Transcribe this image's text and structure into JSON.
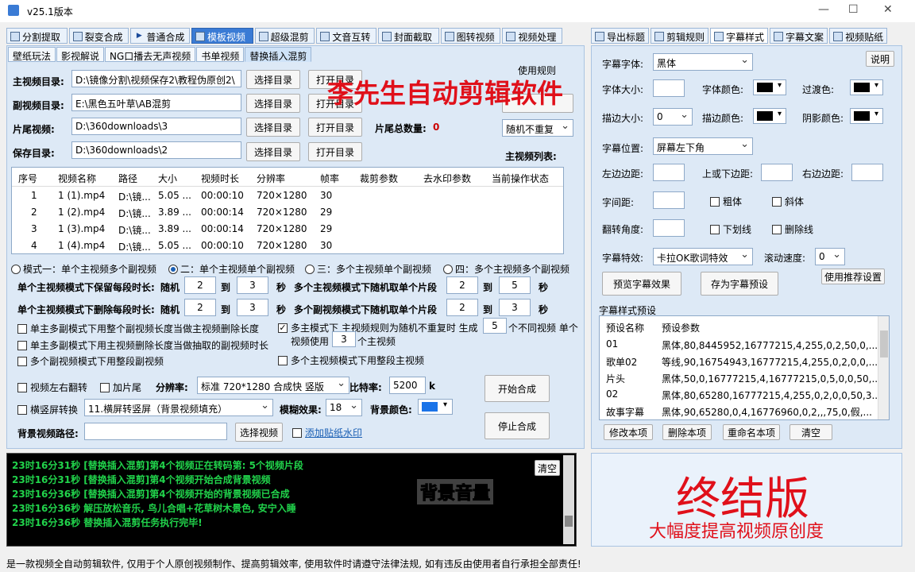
{
  "window": {
    "title": "v25.1版本",
    "min": "—",
    "max": "☐",
    "close": "✕"
  },
  "main_tabs": [
    {
      "label": "分割提取",
      "icon": "film-icon"
    },
    {
      "label": "裂变合成",
      "icon": "layers-icon"
    },
    {
      "label": "普通合成",
      "icon": "play-icon"
    },
    {
      "label": "模板视频",
      "icon": "template-icon",
      "active": true
    },
    {
      "label": "超级混剪",
      "icon": "waveform-icon"
    },
    {
      "label": "文音互转",
      "icon": "microphone-icon"
    },
    {
      "label": "封面截取",
      "icon": "image-icon"
    },
    {
      "label": "图转视频",
      "icon": "picture-video-icon"
    },
    {
      "label": "视频处理",
      "icon": "video-process-icon"
    }
  ],
  "sub_tabs": [
    "壁纸玩法",
    "影视解说",
    "NG口播去无声视频",
    "书单视频",
    "替换插入混剪"
  ],
  "overlay": {
    "title": "李先生自动剪辑软件",
    "big": "终结版",
    "sub": "大幅度提高视频原创度",
    "caption": "背景音量"
  },
  "form": {
    "main_dir_label": "主视频目录:",
    "main_dir_value": "D:\\镜像分割\\视频保存2\\教程伪原创2\\",
    "sub_dir_label": "副视频目录:",
    "sub_dir_value": "E:\\黑色五叶草\\AB混剪",
    "tail_label": "片尾视频:",
    "tail_value": "D:\\360downloads\\3",
    "save_label": "保存目录:",
    "save_value": "D:\\360downloads\\2",
    "select_dir": "选择目录",
    "open_dir": "打开目录",
    "tail_count_label": "片尾总数量:",
    "tail_count": "0",
    "rules_label": "使用规则",
    "rule_select": "随机不重复",
    "main_list_label": "主视频列表:"
  },
  "table": {
    "headers": [
      "序号",
      "视频名称",
      "路径",
      "大小",
      "视频时长",
      "分辨率",
      "帧率",
      "裁剪参数",
      "去水印参数",
      "当前操作状态"
    ],
    "rows": [
      [
        "1",
        "1 (1).mp4",
        "D:\\镜...",
        "5.05 ...",
        "00:00:10",
        "720×1280",
        "30"
      ],
      [
        "2",
        "1 (2).mp4",
        "D:\\镜...",
        "3.89 ...",
        "00:00:14",
        "720×1280",
        "29"
      ],
      [
        "3",
        "1 (3).mp4",
        "D:\\镜...",
        "3.89 ...",
        "00:00:14",
        "720×1280",
        "29"
      ],
      [
        "4",
        "1 (4).mp4",
        "D:\\镜...",
        "5.05 ...",
        "00:00:10",
        "720×1280",
        "30"
      ]
    ]
  },
  "modes": [
    {
      "label": "模式一：单个主视频多个副视频",
      "checked": false
    },
    {
      "label": "二：单个主视频单个副视频",
      "checked": true
    },
    {
      "label": "三：多个主视频单个副视频",
      "checked": false
    },
    {
      "label": "四：多个主视频多个副视频",
      "checked": false
    }
  ],
  "params": {
    "keep_label": "单个主视频模式下保留每段时长:",
    "random": "随机",
    "to": "到",
    "sec": "秒",
    "keep_min": "2",
    "keep_max": "3",
    "del_label": "单个主视频模式下删除每段时长:",
    "del_min": "2",
    "del_max": "3",
    "multi_main_label": "多个主视频模式下随机取单个片段",
    "mm_min": "2",
    "mm_max": "5",
    "multi_sub_label": "多个副视频模式下随机取单个片段",
    "ms_min": "2",
    "ms_max": "3"
  },
  "checks": {
    "c1": "单主多副模式下用整个副视频长度当做主视频删除长度",
    "c2": "单主多副模式下用主视频删除长度当做抽取的副视频时长",
    "c3": "多个副视频模式下用整段副视频",
    "c4a": "多主模式下 主视频规则为随机不重复时 生成",
    "c4_count": "5",
    "c4b": "个不同视频 单个",
    "c4c": "视频使用",
    "c4_use": "3",
    "c4d": "个主视频",
    "c5": "多个主视频模式下用整段主视频"
  },
  "bottom": {
    "flip": "视频左右翻转",
    "tail": "加片尾",
    "res_label": "分辨率:",
    "res_value": "标准 720*1280 合成快 竖版",
    "bitrate_label": "比特率:",
    "bitrate": "5200",
    "k": "k",
    "landscape": "横竖屏转换",
    "landscape_value": "11.横屏转竖屏（背景视频填充）",
    "blur_label": "模糊效果:",
    "blur_value": "18",
    "bg_color_label": "背景颜色:",
    "bg_color": "#1a73e8",
    "bg_path_label": "背景视频路径:",
    "select_video": "选择视频",
    "watermark": "添加贴纸水印",
    "start": "开始合成",
    "stop": "停止合成"
  },
  "right_tabs": [
    {
      "label": "导出标题",
      "icon": "export-icon"
    },
    {
      "label": "剪辑规则",
      "icon": "film-rule-icon"
    },
    {
      "label": "字幕样式",
      "icon": "subtitle-style-icon",
      "active": true
    },
    {
      "label": "字幕文案",
      "icon": "text-icon"
    },
    {
      "label": "视频贴纸",
      "icon": "sticker-icon"
    }
  ],
  "subtitle": {
    "font_label": "字幕字体:",
    "font_value": "黑体",
    "help": "说明",
    "size_label": "字体大小:",
    "color_label": "字体颜色:",
    "trans_label": "过渡色:",
    "stroke_size_label": "描边大小:",
    "stroke_size": "0",
    "stroke_color_label": "描边颜色:",
    "shadow_label": "阴影颜色:",
    "pos_label": "字幕位置:",
    "pos_value": "屏幕左下角",
    "left_margin": "左边边距:",
    "tb_margin": "上或下边距:",
    "right_margin": "右边边距:",
    "spacing": "字间距:",
    "bold": "粗体",
    "italic": "斜体",
    "rotate": "翻转角度:",
    "underline": "下划线",
    "strike": "删除线",
    "effect_label": "字幕特效:",
    "effect_value": "卡拉OK歌词特效",
    "scroll_label": "滚动速度:",
    "scroll_value": "0",
    "preview": "预览字幕效果",
    "save_preset": "存为字幕预设",
    "use_recommended": "使用推荐设置"
  },
  "preset": {
    "title": "字幕样式预设",
    "headers": [
      "预设名称",
      "预设参数"
    ],
    "rows": [
      [
        "01",
        "黑体,80,8445952,16777215,4,255,0,2,50,0,..."
      ],
      [
        "歌单02",
        "等线,90,16754943,16777215,4,255,0,2,0,0,..."
      ],
      [
        "片头",
        "黑体,50,0,16777215,4,16777215,0,5,0,0,50,..."
      ],
      [
        "02",
        "黑体,80,65280,16777215,4,255,0,2,0,0,50,3..."
      ],
      [
        "故事字幕",
        "黑体,90,65280,0,4,16776960,0,2,,,75,0,假,..."
      ]
    ],
    "edit": "修改本项",
    "delete": "删除本项",
    "rename": "重命名本项",
    "clear": "清空"
  },
  "log": {
    "clear": "清空",
    "lines": [
      "23时16分31秒 [替换插入混剪]第4个视频正在转码第: 5个视频片段",
      "23时16分31秒 [替换插入混剪]第4个视频开始合成背景视频",
      "23时16分36秒 [替换插入混剪]第4个视频开始的背景视频已合成",
      "23时16分36秒 解压放松音乐, 鸟儿合唱+花草树木景色, 安宁入睡",
      "23时16分36秒 替换插入混剪任务执行完毕!"
    ]
  },
  "status_text": "是一款视频全自动剪辑软件, 仅用于个人原创视频制作、提高剪辑效率, 使用软件时请遵守法律法规, 如有违反由使用者自行承担全部责任!"
}
